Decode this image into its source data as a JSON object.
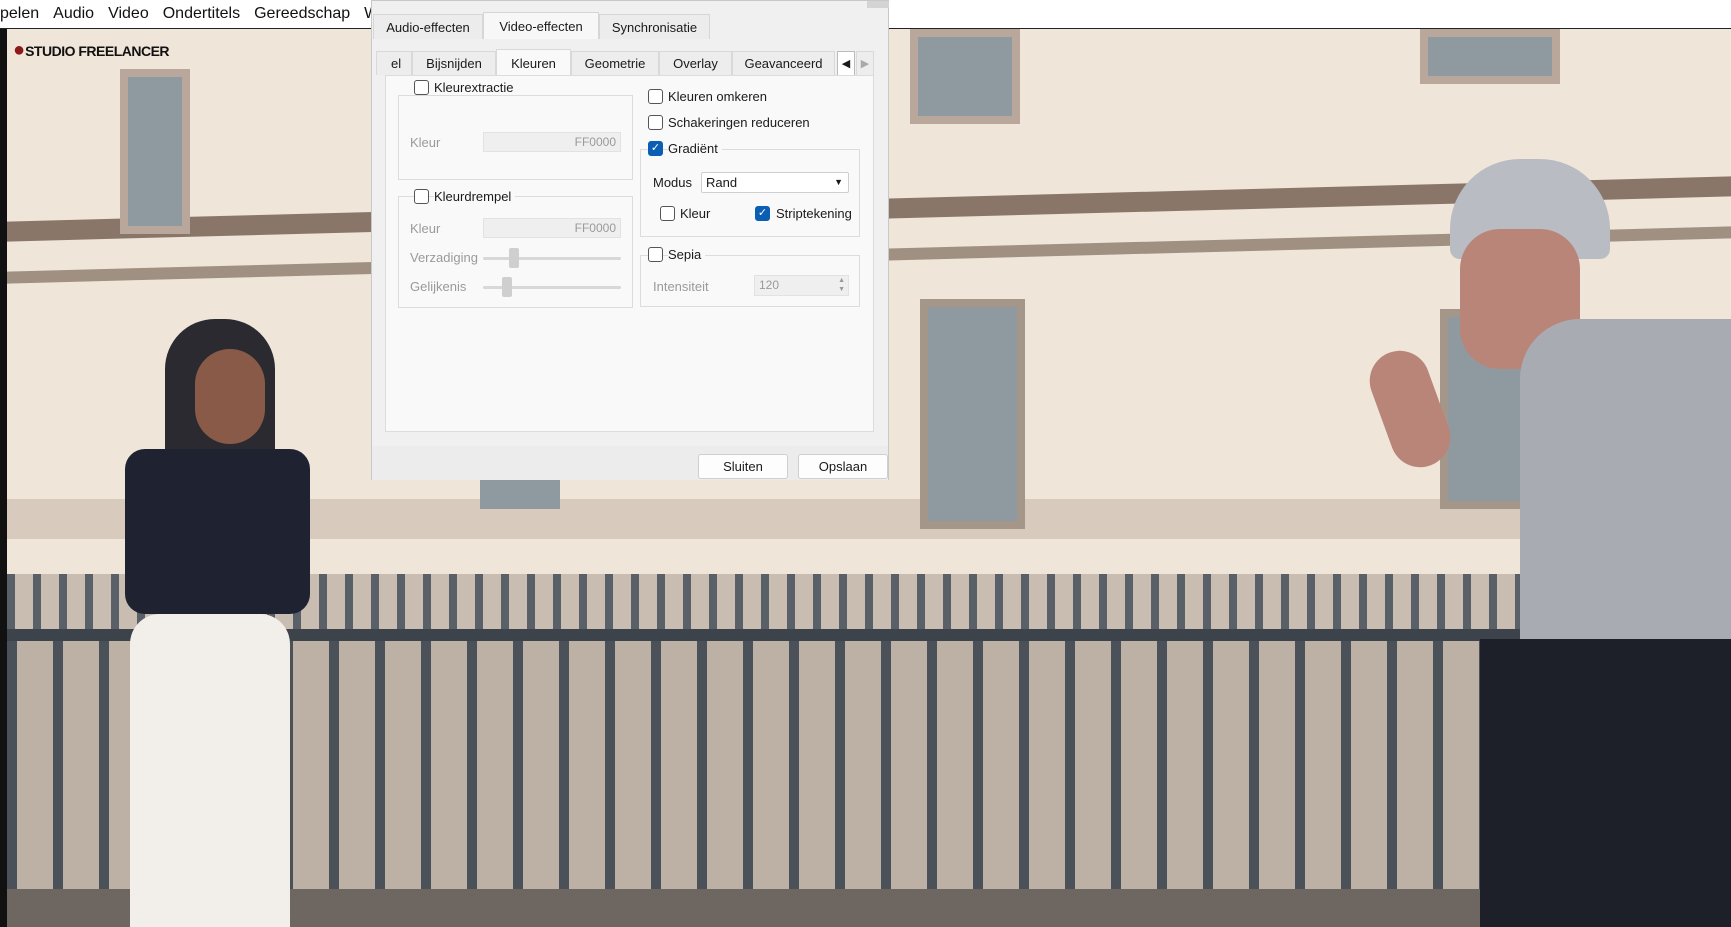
{
  "menu": {
    "items": [
      "pelen",
      "Audio",
      "Video",
      "Ondertitels",
      "Gereedschap",
      "We"
    ]
  },
  "logo": {
    "text": "STUDIO FREELANCER"
  },
  "dialog": {
    "top_tabs": [
      "Audio-effecten",
      "Video-effecten",
      "Synchronisatie"
    ],
    "selected_top_tab": "Video-effecten",
    "inner_tabs": [
      "el",
      "Bijsnijden",
      "Kleuren",
      "Geometrie",
      "Overlay",
      "Geavanceerd"
    ],
    "selected_inner_tab": "Kleuren",
    "kleurextractie": {
      "label": "Kleurextractie",
      "checked": false,
      "kleur_label": "Kleur",
      "kleur_value": "FF0000"
    },
    "kleurdrempel": {
      "label": "Kleurdrempel",
      "checked": false,
      "kleur_label": "Kleur",
      "kleur_value": "FF0000",
      "verzadiging_label": "Verzadiging",
      "verzadiging_level": 0.2,
      "gelijkenis_label": "Gelijkenis",
      "gelijkenis_level": 0.15
    },
    "kleuren_omkeren": {
      "label": "Kleuren omkeren",
      "checked": false
    },
    "schakeringen": {
      "label": "Schakeringen reduceren",
      "checked": false
    },
    "gradient": {
      "label": "Gradiënt",
      "checked": true,
      "modus_label": "Modus",
      "modus_value": "Rand",
      "kleur_label": "Kleur",
      "kleur_checked": false,
      "strip_label": "Striptekening",
      "strip_checked": true
    },
    "sepia": {
      "label": "Sepia",
      "checked": false,
      "intensiteit_label": "Intensiteit",
      "intensiteit_value": "120"
    },
    "buttons": {
      "close": "Sluiten",
      "save": "Opslaan"
    },
    "accent": "#0a5fb4"
  }
}
